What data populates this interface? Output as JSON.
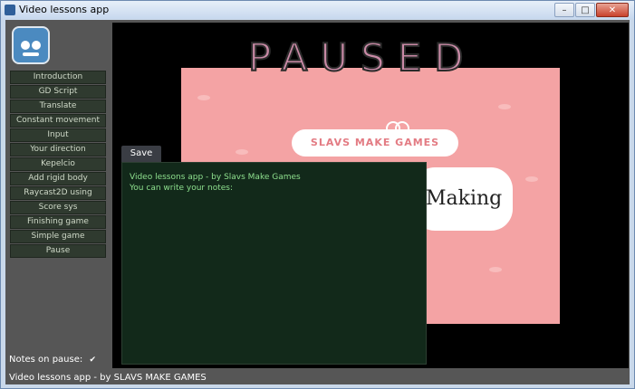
{
  "window": {
    "title": "Video lessons app",
    "buttons": {
      "minimize": "–",
      "maximize": "□",
      "close": "✕"
    }
  },
  "sidebar": {
    "items": [
      {
        "label": "Introduction"
      },
      {
        "label": "GD Script"
      },
      {
        "label": "Translate"
      },
      {
        "label": "Constant movement"
      },
      {
        "label": "Input"
      },
      {
        "label": "Your direction"
      },
      {
        "label": "Kepelcio"
      },
      {
        "label": "Add rigid body"
      },
      {
        "label": "Raycast2D using"
      },
      {
        "label": "Score sys"
      },
      {
        "label": "Finishing game"
      },
      {
        "label": "Simple game"
      },
      {
        "label": "Pause"
      }
    ],
    "notes_on_pause_label": "Notes on pause:",
    "notes_on_pause_checked": true,
    "checkbox_glyph": "✔"
  },
  "viewport": {
    "paused_text": "PAUSED",
    "logo_text": "SLAVS MAKE GAMES",
    "making_text": "Making"
  },
  "notes": {
    "save_label": "Save",
    "line1": "Video lessons app - by Slavs Make Games",
    "line2": "You can  write your notes:"
  },
  "footer": {
    "text": "Video lessons app - by SLAVS MAKE GAMES"
  },
  "colors": {
    "pink_background": "#f4a3a4",
    "notes_background": "#12291a",
    "notes_text": "#8ee08e",
    "menu_button": "#2f3a2f"
  }
}
